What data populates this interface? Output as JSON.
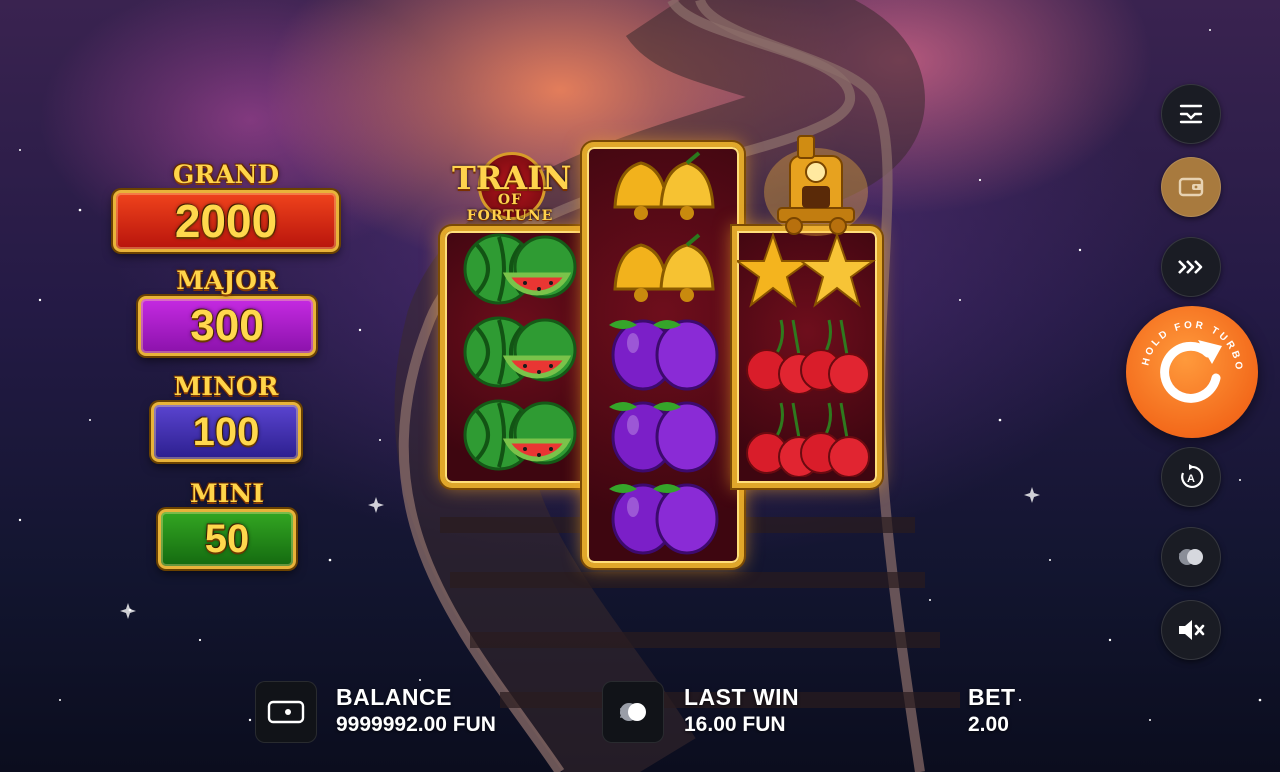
{
  "game": {
    "logo_title": "TRAIN",
    "logo_subtitle": "OF FORTUNE"
  },
  "jackpots": [
    {
      "label": "GRAND",
      "value": "2000",
      "color": "#d8261a"
    },
    {
      "label": "MAJOR",
      "value": "300",
      "color": "#a51ac6"
    },
    {
      "label": "MINOR",
      "value": "100",
      "color": "#3f2aa8"
    },
    {
      "label": "MINI",
      "value": "50",
      "color": "#1f7c18"
    }
  ],
  "reels": {
    "columns": [
      {
        "symbols": [
          "watermelon",
          "watermelon",
          "watermelon"
        ]
      },
      {
        "symbols": [
          "bell",
          "bell",
          "plum",
          "plum",
          "plum"
        ]
      },
      {
        "symbols": [
          "star",
          "cherry",
          "cherry"
        ]
      }
    ],
    "bonus_symbol": "train-icon"
  },
  "controls": {
    "menu": "settings-menu-icon",
    "wallet": "wallet-icon",
    "speed": "fast-forward-icon",
    "spin_hint": "HOLD FOR TURBO",
    "autoplay": "autoplay-icon",
    "bet": "coins-icon",
    "sound": "mute-icon"
  },
  "bottom_bar": {
    "balance_label": "BALANCE",
    "balance_value": "9999992.00 FUN",
    "last_win_label": "LAST WIN",
    "last_win_value": "16.00 FUN",
    "bet_label": "BET",
    "bet_value": "2.00"
  },
  "colors": {
    "frame_gold": "#e0a72a",
    "spin_orange": "#f36a1b",
    "reel_bg": "#5a0a16"
  }
}
